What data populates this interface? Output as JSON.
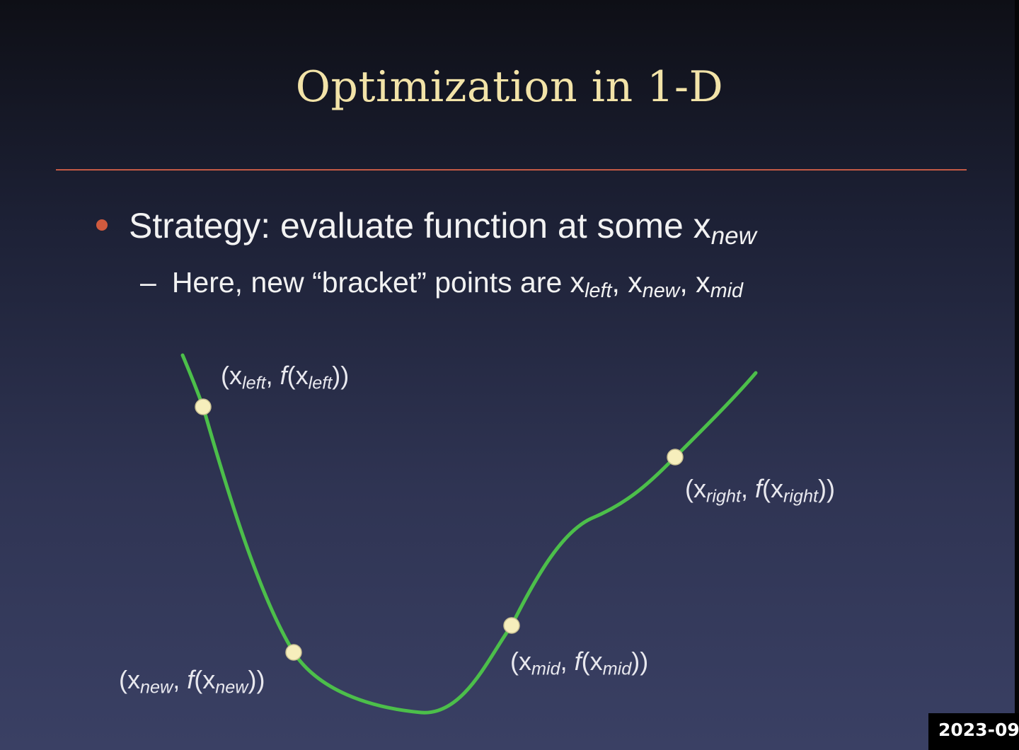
{
  "slide": {
    "title": "Optimization in 1-D",
    "bullet": {
      "text": "Strategy: evaluate function at some x",
      "sub": "new"
    },
    "sub_bullet": {
      "dash": "–",
      "text": "Here, new “bracket” points are x",
      "s1": "left",
      "c1": ", x",
      "s2": "new",
      "c2": ", x",
      "s3": "mid"
    },
    "accent_color": "#c45a45",
    "curve_color": "#4cbf4a",
    "point_color": "#f6eebc"
  },
  "diagram": {
    "points": [
      {
        "id": "left",
        "pre": "(x",
        "sub1": "left",
        "mid": ", ",
        "f": "f",
        "open": "(x",
        "sub2": "left",
        "close": "))"
      },
      {
        "id": "right",
        "pre": "(x",
        "sub1": "right",
        "mid": ", ",
        "f": "f",
        "open": "(x",
        "sub2": "right",
        "close": "))"
      },
      {
        "id": "mid",
        "pre": "(x",
        "sub1": "mid",
        "mid": ", ",
        "f": "f",
        "open": "(x",
        "sub2": "mid",
        "close": "))"
      },
      {
        "id": "new",
        "pre": "(x",
        "sub1": "new",
        "mid": ", ",
        "f": "f",
        "open": "(x",
        "sub2": "new",
        "close": "))"
      }
    ]
  },
  "overlay": {
    "timestamp": "2023-09"
  }
}
